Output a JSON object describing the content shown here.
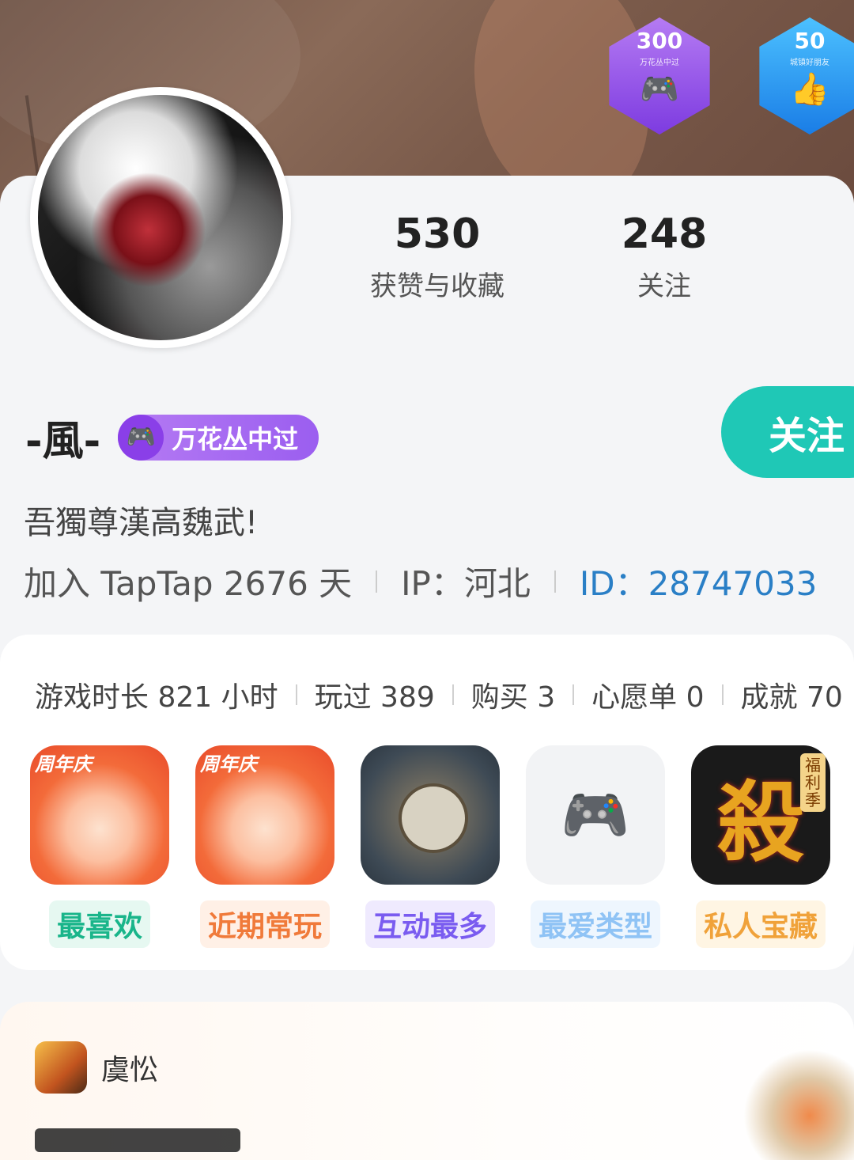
{
  "badges": [
    {
      "number": "300",
      "subtitle": "万花丛中过",
      "icon": "gamepad-icon",
      "color": "#9b5ef0"
    },
    {
      "number": "50",
      "subtitle": "城镇好朋友",
      "icon": "thumbs-up-icon",
      "color": "#1a7de6"
    }
  ],
  "stats": {
    "likes_value": "530",
    "likes_label": "获赞与收藏",
    "following_value": "248",
    "following_label": "关注"
  },
  "profile": {
    "username": "-風-",
    "title_badge": "万花丛中过",
    "follow_button": "关注",
    "bio": "吾獨尊漢高魏武!",
    "join_text": "加入 TapTap 2676 天",
    "ip_text": "IP：河北",
    "id_text": "ID：28747033"
  },
  "game_stats": [
    "游戏时长 821 小时",
    "玩过 389",
    "购买 3",
    "心愿单 0",
    "成就 70"
  ],
  "game_tiles": [
    {
      "label": "最喜欢",
      "banner": "周年庆",
      "label_color": "#19b58a",
      "label_bg": "#e6f8f1"
    },
    {
      "label": "近期常玩",
      "banner": "周年庆",
      "label_color": "#f07a3a",
      "label_bg": "#fff0e6"
    },
    {
      "label": "互动最多",
      "label_color": "#7a5cf0",
      "label_bg": "#efeafe"
    },
    {
      "label": "最爱类型",
      "label_color": "#8fc3f5",
      "label_bg": "#eef6fe"
    },
    {
      "label": "私人宝藏",
      "kill_char": "殺",
      "side_tag": "福利季",
      "label_color": "#f0a23a",
      "label_bg": "#fff5e3"
    }
  ],
  "post": {
    "author": "虞忪"
  }
}
